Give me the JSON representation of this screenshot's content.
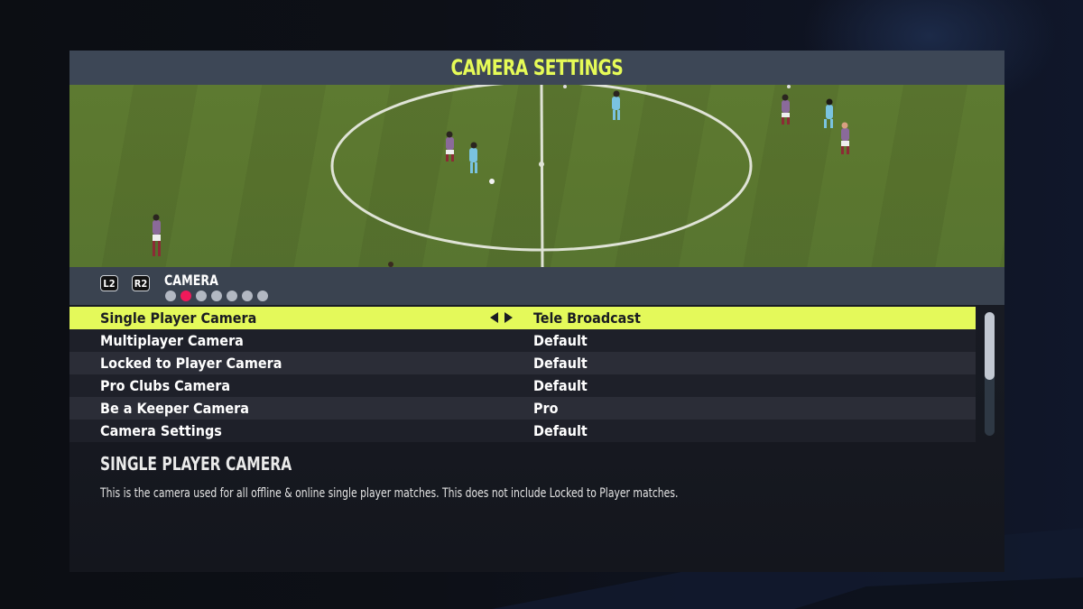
{
  "header": {
    "title": "CAMERA SETTINGS"
  },
  "tab_nav": {
    "prev_button": "L2",
    "next_button": "R2",
    "current_tab": "CAMERA",
    "page_count": 7,
    "active_page": 2
  },
  "settings": [
    {
      "label": "Single Player Camera",
      "value": "Tele Broadcast",
      "selected": true
    },
    {
      "label": "Multiplayer Camera",
      "value": "Default",
      "selected": false
    },
    {
      "label": "Locked to Player Camera",
      "value": "Default",
      "selected": false
    },
    {
      "label": "Pro Clubs Camera",
      "value": "Default",
      "selected": false
    },
    {
      "label": "Be a Keeper Camera",
      "value": "Pro",
      "selected": false
    },
    {
      "label": "Camera Settings",
      "value": "Default",
      "selected": false
    }
  ],
  "description": {
    "title": "SINGLE PLAYER CAMERA",
    "text": "This is the camera used for all offline & online single player matches. This does not include Locked to Player matches."
  },
  "colors": {
    "accent": "#e4f95a",
    "title_bar": "#3d4756",
    "active_dot": "#f0195a",
    "inactive_dot": "#b2b8c2"
  },
  "icons": {
    "value_arrows": "left-right-arrows-icon"
  }
}
